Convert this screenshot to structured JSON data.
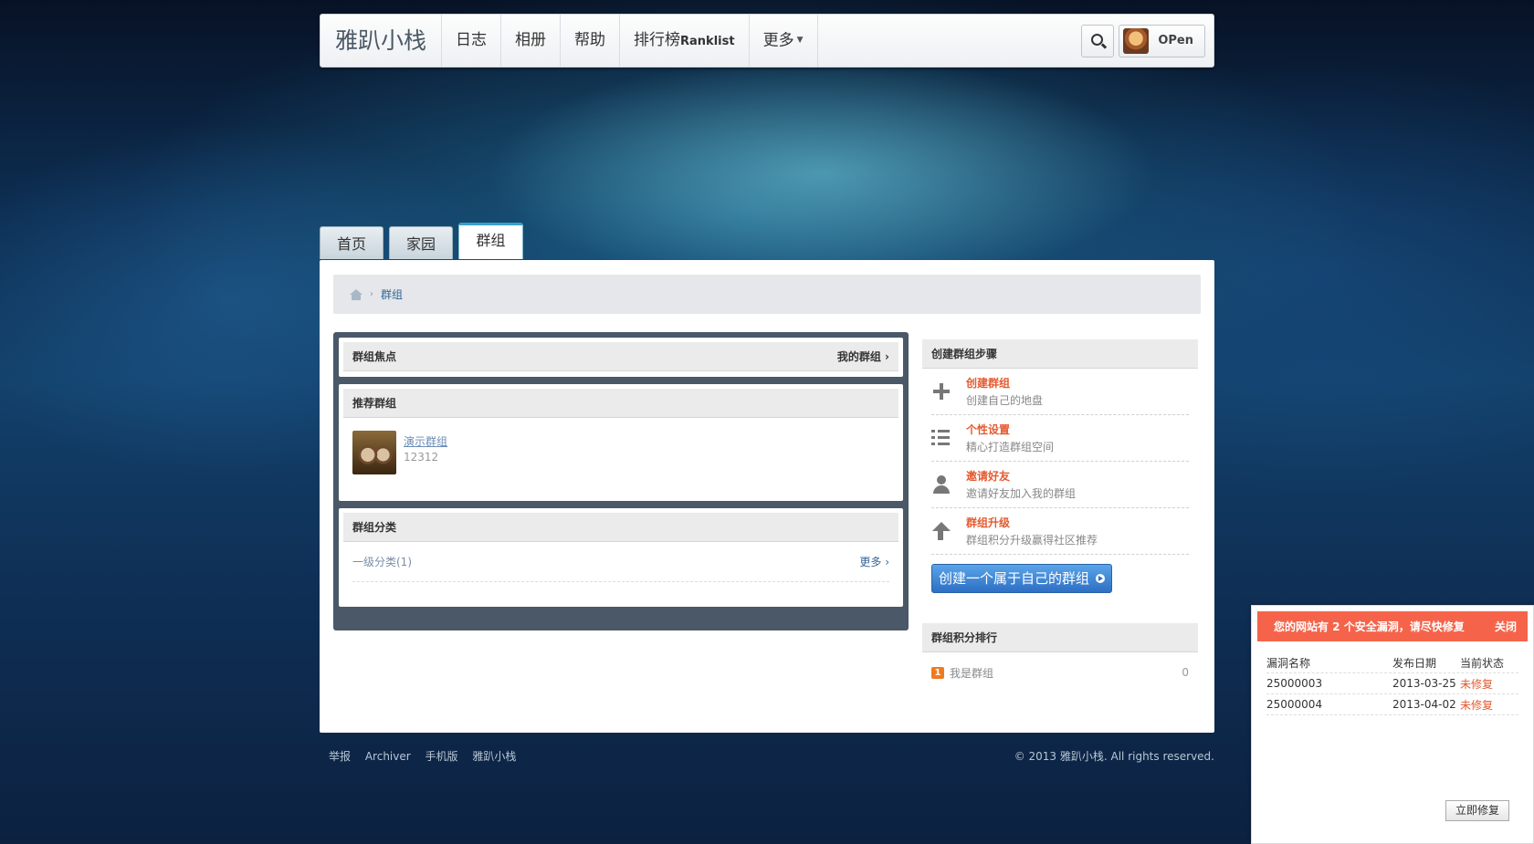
{
  "header": {
    "logo": "雅趴小栈",
    "nav": [
      "日志",
      "相册",
      "帮助"
    ],
    "ranklist_main": "排行榜",
    "ranklist_suffix": "Ranklist",
    "more": "更多",
    "user_name": "OPen"
  },
  "tabs": [
    "首页",
    "家园",
    "群组"
  ],
  "breadcrumb": {
    "sep": "›",
    "current": "群组"
  },
  "left": {
    "focus_title": "群组焦点",
    "my_groups": "我的群组 ›",
    "recommend_title": "推荐群组",
    "group": {
      "name": "演示群组",
      "number": "12312"
    },
    "category_title": "群组分类",
    "category_item": "一级分类(1)",
    "category_more": "更多 ›"
  },
  "right": {
    "steps_title": "创建群组步骤",
    "steps": [
      {
        "title": "创建群组",
        "desc": "创建自己的地盘",
        "icon": "plus-icon"
      },
      {
        "title": "个性设置",
        "desc": "精心打造群组空间",
        "icon": "list-icon"
      },
      {
        "title": "邀请好友",
        "desc": "邀请好友加入我的群组",
        "icon": "user-icon"
      },
      {
        "title": "群组升级",
        "desc": "群组积分升级赢得社区推荐",
        "icon": "up-arrow-icon"
      }
    ],
    "create_button": "创建一个属于自己的群组",
    "rank_title": "群组积分排行",
    "rank": {
      "badge": "1",
      "name": "我是群组",
      "score": "0"
    }
  },
  "footer": {
    "links": [
      "举报",
      "Archiver",
      "手机版",
      "雅趴小栈"
    ],
    "copyright": "© 2013 雅趴小栈. All rights reserved."
  },
  "alert": {
    "title": "您的网站有 2 个安全漏洞，请尽快修复",
    "close": "关闭",
    "columns": [
      "漏洞名称",
      "发布日期",
      "当前状态"
    ],
    "rows": [
      {
        "name": "25000003",
        "date": "2013-03-25",
        "status": "未修复"
      },
      {
        "name": "25000004",
        "date": "2013-04-02",
        "status": "未修复"
      }
    ],
    "fix_button": "立即修复"
  },
  "colors": {
    "accent_orange": "#e45a30",
    "button_blue": "#2e6fc4",
    "alert_red": "#f5644a"
  }
}
